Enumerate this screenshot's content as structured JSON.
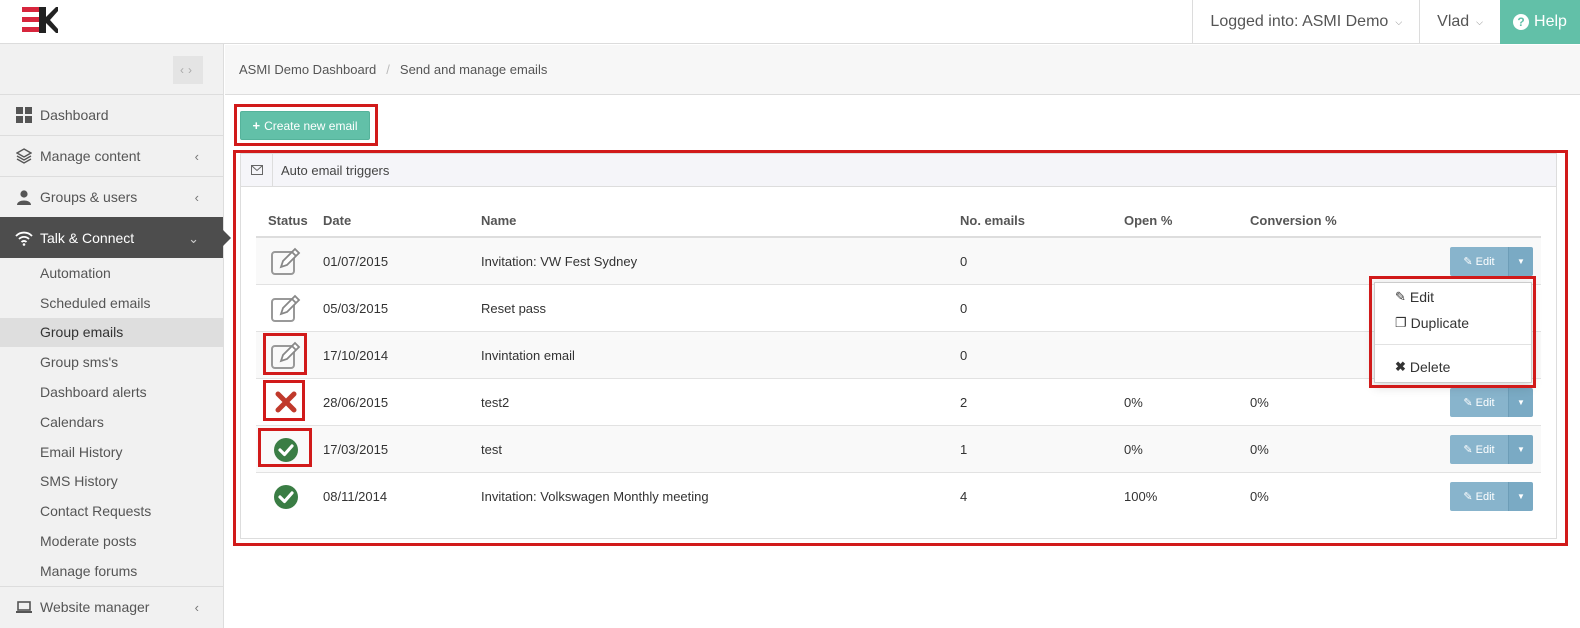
{
  "header": {
    "logged_into": "Logged into: ASMI Demo",
    "user": "Vlad",
    "help": "Help"
  },
  "sidebar": {
    "items": [
      {
        "label": "Dashboard"
      },
      {
        "label": "Manage content"
      },
      {
        "label": "Groups & users"
      },
      {
        "label": "Talk & Connect"
      }
    ],
    "subitems": [
      "Automation",
      "Scheduled emails",
      "Group emails",
      "Group sms's",
      "Dashboard alerts",
      "Calendars",
      "Email History",
      "SMS History",
      "Contact Requests",
      "Moderate posts",
      "Manage forums"
    ],
    "bottom_item": "Website manager"
  },
  "breadcrumb": {
    "home": "ASMI Demo Dashboard",
    "current": "Send and manage emails"
  },
  "create_button": "Create new email",
  "panel": {
    "title": "Auto email triggers",
    "columns": [
      "Status",
      "Date",
      "Name",
      "No. emails",
      "Open %",
      "Conversion %"
    ],
    "rows": [
      {
        "status": "draft",
        "date": "01/07/2015",
        "name": "Invitation: VW Fest Sydney",
        "emails": "0",
        "open": "",
        "conversion": ""
      },
      {
        "status": "draft",
        "date": "05/03/2015",
        "name": "Reset pass",
        "emails": "0",
        "open": "",
        "conversion": ""
      },
      {
        "status": "draft",
        "date": "17/10/2014",
        "name": "Invintation email",
        "emails": "0",
        "open": "",
        "conversion": ""
      },
      {
        "status": "failed",
        "date": "28/06/2015",
        "name": "test2",
        "emails": "2",
        "open": "0%",
        "conversion": "0%"
      },
      {
        "status": "sent",
        "date": "17/03/2015",
        "name": "test",
        "emails": "1",
        "open": "0%",
        "conversion": "0%"
      },
      {
        "status": "sent",
        "date": "08/11/2014",
        "name": "Invitation: Volkswagen Monthly meeting",
        "emails": "4",
        "open": "100%",
        "conversion": "0%"
      }
    ],
    "edit_label": "Edit"
  },
  "dropdown": {
    "edit": "Edit",
    "duplicate": "Duplicate",
    "delete": "Delete"
  },
  "colors": {
    "accent": "#62c0a8",
    "sidebar_active": "#4d4d4d",
    "edit_button": "#88b4cc",
    "highlight": "#d11a1a",
    "success": "#3a7d44",
    "danger": "#c0392b"
  }
}
